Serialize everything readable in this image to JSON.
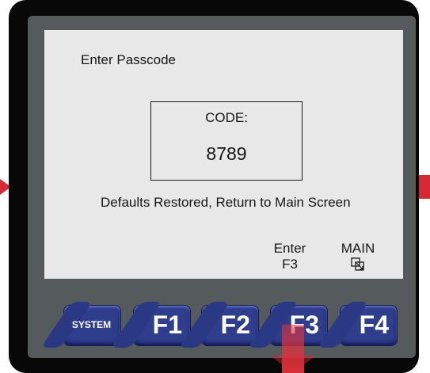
{
  "screen": {
    "title": "Enter Passcode",
    "code_label": "CODE:",
    "code_value": "8789",
    "message": "Defaults Restored, Return to Main Screen",
    "softkeys": {
      "enter": "Enter",
      "enter_fn": "F3",
      "main": "MAIN",
      "main_icon": "window-switch-icon"
    }
  },
  "keys": {
    "system": "SYSTEM",
    "f1": "F1",
    "f2": "F2",
    "f3": "F3",
    "f4": "F4"
  },
  "colors": {
    "accent_red": "#d62835",
    "key_blue": "#2f3d8d",
    "screen_bg": "#e8e8e8",
    "bezel": "#555a5d"
  }
}
